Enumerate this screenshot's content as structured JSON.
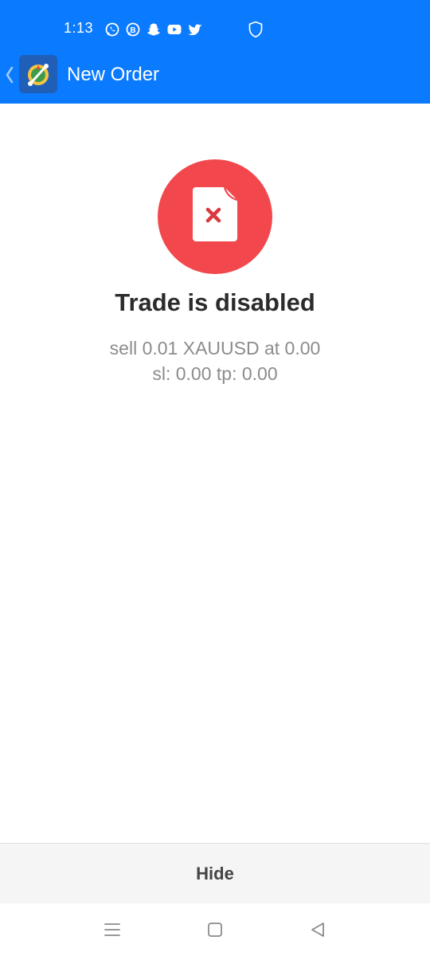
{
  "status_bar": {
    "time": "1:13",
    "icons": [
      "whatsapp-icon",
      "whatsapp-business-icon",
      "snapchat-icon",
      "youtube-icon",
      "twitter-icon",
      "shield-icon"
    ]
  },
  "app_bar": {
    "title": "New Order",
    "back_icon": "chevron-left-icon",
    "logo": "metatrader-logo",
    "color": "#0a7aff"
  },
  "result": {
    "icon": "document-error-icon",
    "accent_color": "#f2484d",
    "headline": "Trade is disabled",
    "line1": "sell 0.01 XAUUSD at 0.00",
    "line2": "sl: 0.00 tp: 0.00"
  },
  "footer": {
    "hide_label": "Hide"
  },
  "system_nav": {
    "buttons": [
      "menu-icon",
      "home-icon",
      "back-icon"
    ]
  }
}
